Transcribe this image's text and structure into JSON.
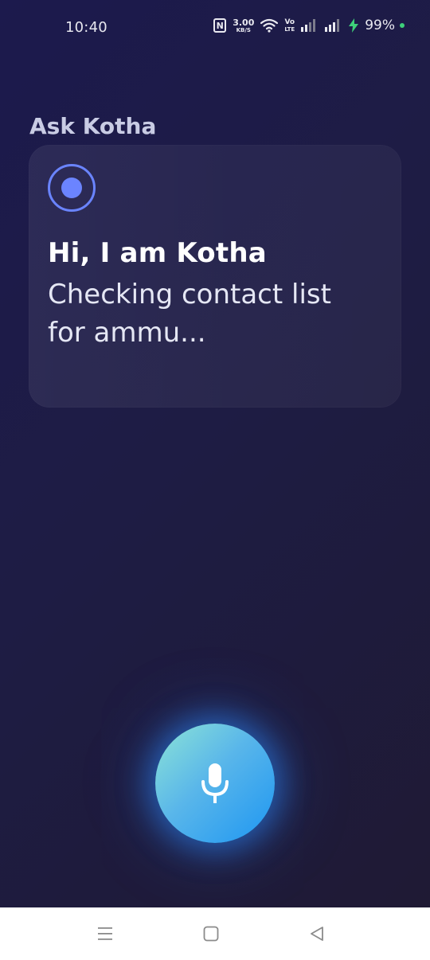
{
  "status_bar": {
    "time": "10:40",
    "nfc_label": "N",
    "network_speed_value": "3.00",
    "network_speed_unit": "KB/S",
    "volte_top": "Vo",
    "volte_bottom": "LTE",
    "battery_percent": "99%",
    "icons": [
      "nfc-icon",
      "wifi-icon",
      "volte-icon",
      "signal-icon",
      "signal-icon",
      "charging-bolt-icon",
      "status-dot-icon"
    ],
    "colors": {
      "bolt": "#3ed07a",
      "dot": "#3ed07a"
    }
  },
  "header": {
    "title": "Ask Kotha"
  },
  "assistant_card": {
    "indicator_icon": "record-indicator-icon",
    "greeting": "Hi, I am Kotha",
    "status_message": "Checking contact list for ammu..."
  },
  "mic_button": {
    "icon": "microphone-icon",
    "accent_colors": [
      "#8de4d6",
      "#1d96f2"
    ]
  },
  "nav_bar": {
    "items": [
      {
        "name": "menu",
        "icon": "menu-icon"
      },
      {
        "name": "home",
        "icon": "home-square-icon"
      },
      {
        "name": "back",
        "icon": "back-triangle-icon"
      }
    ]
  },
  "theme": {
    "background_start": "#1c1a4d",
    "background_end": "#1f1a33",
    "accent": "#6a84ff"
  }
}
